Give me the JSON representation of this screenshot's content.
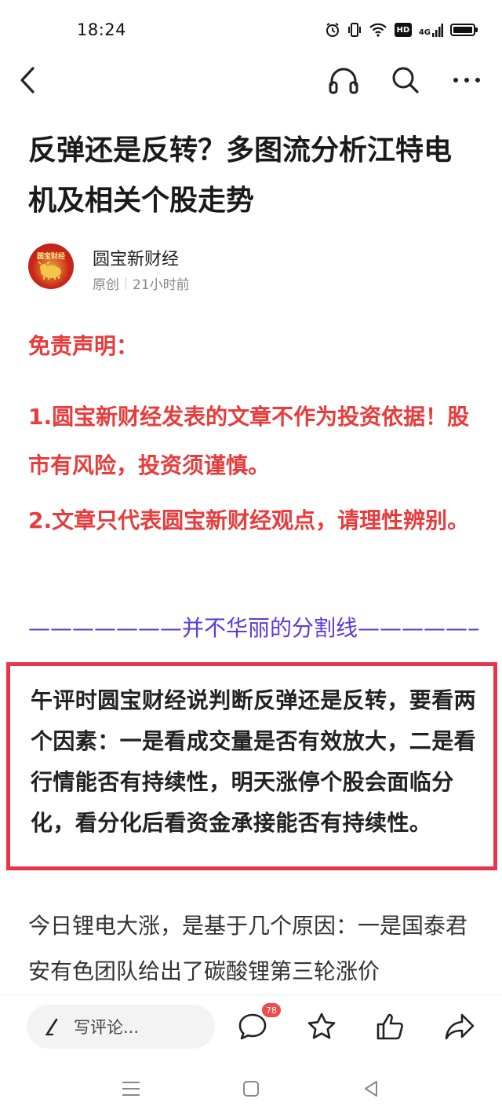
{
  "status_bar": {
    "time": "18:24",
    "icons": [
      "alarm-icon",
      "vibrate-icon",
      "wifi-icon",
      "hd-icon",
      "signal-4g-icon",
      "battery-icon"
    ],
    "hd_label": "HD",
    "network_label": "4G"
  },
  "top_nav": {
    "icons": [
      "back-icon",
      "headphones-icon",
      "search-icon",
      "more-icon"
    ]
  },
  "article": {
    "title": "反弹还是反转？多图流分析江特电机及相关个股走势",
    "author": {
      "name": "圆宝新财经",
      "avatar_text": "圆宝财经",
      "tag": "原创",
      "time": "21小时前"
    },
    "disclaimer_title": "免责声明：",
    "disclaimer_1": "1.圆宝新财经发表的文章不作为投资依据！股市有风险，投资须谨慎。",
    "disclaimer_2": "2.文章只代表圆宝新财经观点，请理性辨别。",
    "divider": "———————并不华丽的分割线——————",
    "highlight": "午评时圆宝财经说判断反弹还是反转，要看两个因素：一是看成交量是否有效放大，二是看行情能否有持续性，明天涨停个股会面临分化，看分化后看资金承接能否有持续性。",
    "body": "今日锂电大涨，是基于几个原因：一是国泰君安有色团队给出了碳酸锂第三轮涨价"
  },
  "bottom_bar": {
    "comment_placeholder": "写评论...",
    "comment_count": "78",
    "icons": [
      "comment-icon",
      "star-icon",
      "thumbs-up-icon",
      "share-icon"
    ]
  },
  "colors": {
    "disclaimer_red": "#e83c3c",
    "divider_purple": "#5a3cd8",
    "highlight_border": "#e8344a",
    "badge_red": "#f04a4a"
  }
}
